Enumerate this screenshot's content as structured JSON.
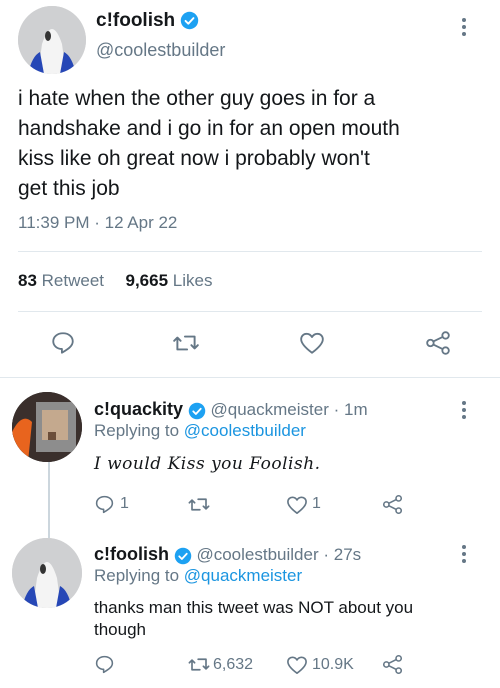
{
  "main_tweet": {
    "display_name": "c!foolish",
    "handle": "@coolestbuilder",
    "text_lines": [
      "i hate when the other guy goes in for a",
      "handshake and i go in for an open mouth",
      "kiss like oh great now i probably won't",
      "get this job"
    ],
    "timestamp": "11:39 PM · 12 Apr 22",
    "retweet_count": "83",
    "retweet_label": "Retweet",
    "likes_count": "9,665",
    "likes_label": "Likes"
  },
  "replies": [
    {
      "display_name": "c!quackity",
      "handle": "@quackmeister",
      "time": "· 1m",
      "replying_prefix": "Replying to",
      "replying_to": "@coolestbuilder",
      "text": "I would Kiss you Foolish.",
      "reply_count": "1",
      "retweet_count": "",
      "like_count": "1"
    },
    {
      "display_name": "c!foolish",
      "handle": "@coolestbuilder",
      "time": "· 27s",
      "replying_prefix": "Replying to",
      "replying_to": "@quackmeister",
      "text_lines": [
        "thanks man this tweet was NOT about you",
        "though"
      ],
      "reply_count": "",
      "retweet_count": "6,632",
      "like_count": "10.9K"
    }
  ],
  "icons": {
    "reply": "reply-icon",
    "retweet": "retweet-icon",
    "like": "heart-icon",
    "share": "share-icon",
    "more": "more-icon",
    "verified": "verified-badge-icon"
  },
  "colors": {
    "text": "#14171a",
    "secondary": "#657786",
    "link": "#1b95e0",
    "verified": "#1da1f2",
    "divider": "#e1e8ed"
  }
}
